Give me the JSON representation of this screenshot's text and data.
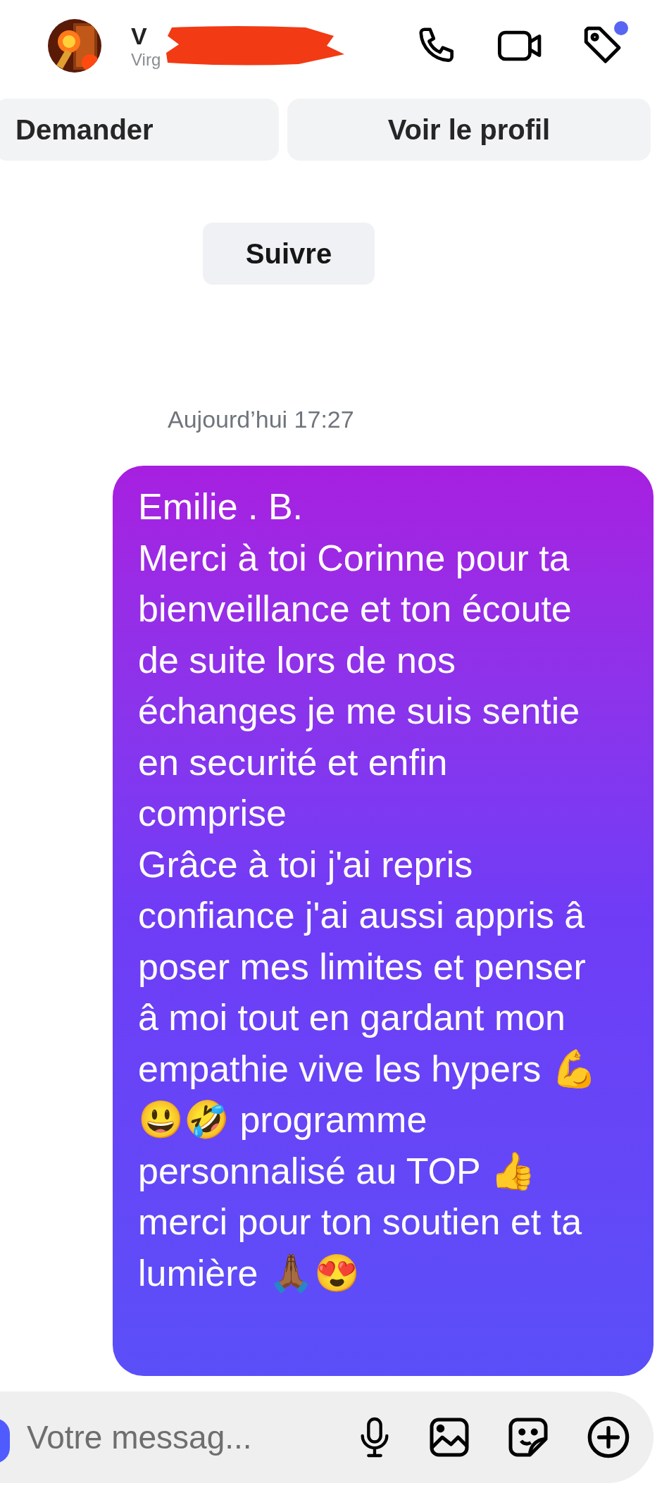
{
  "header": {
    "name": "V",
    "username": "Virg",
    "notification_dot": true
  },
  "actions": [
    {
      "label": "Demander"
    },
    {
      "label": "Voir le profil"
    }
  ],
  "follow_button": "Suivre",
  "date": "Aujourd’hui 17:27",
  "messages": [
    {
      "text": "Emilie . B.\nMerci à toi Corinne pour ta bienveillance et ton écoute de suite lors de nos échanges je me suis sentie en securité et enfin comprise\nGrâce à toi j'ai repris confiance j'ai aussi appris â poser mes limites et penser â moi tout en gardant mon empathie vive les hypers 💪 😃🤣 programme  personnalisé au TOP 👍   merci pour ton soutien et ta lumière 🙏🏾😍"
    }
  ],
  "composer": {
    "placeholder": "Votre messag..."
  }
}
